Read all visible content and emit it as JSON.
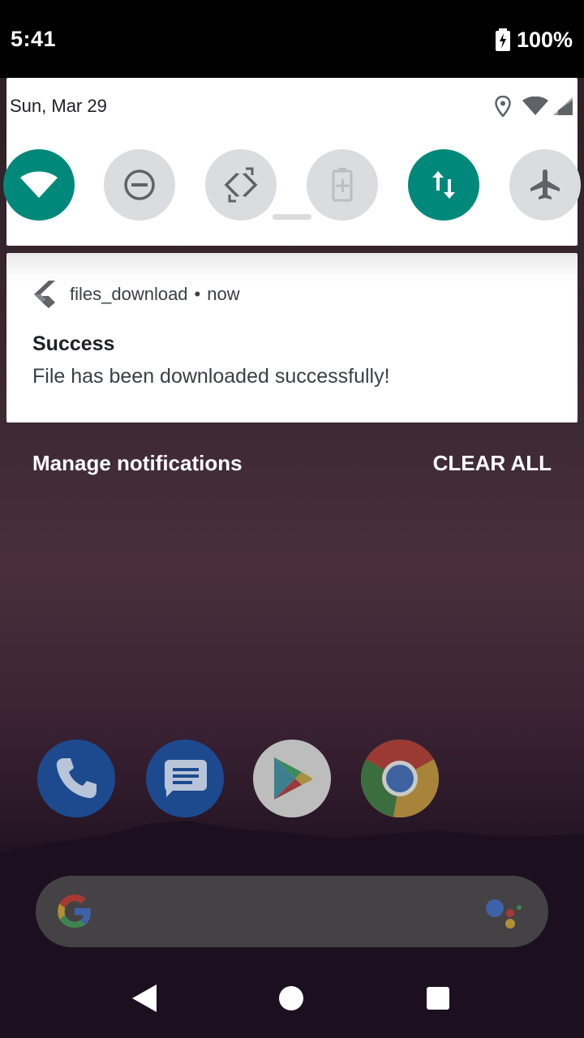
{
  "status_bar": {
    "time": "5:41",
    "battery": "100%"
  },
  "quick_settings": {
    "date": "Sun, Mar 29",
    "accent": "#00897b",
    "tiles": [
      {
        "name": "wifi",
        "icon": "wifi-icon",
        "active": true
      },
      {
        "name": "do-not-disturb",
        "icon": "do-not-disturb-icon",
        "active": false
      },
      {
        "name": "auto-rotate",
        "icon": "auto-rotate-icon",
        "active": false
      },
      {
        "name": "battery-saver",
        "icon": "battery-saver-icon",
        "active": false
      },
      {
        "name": "mobile-data",
        "icon": "mobile-data-icon",
        "active": true
      },
      {
        "name": "airplane-mode",
        "icon": "airplane-icon",
        "active": false
      }
    ]
  },
  "notification": {
    "app_name": "files_download",
    "separator": "•",
    "time": "now",
    "title": "Success",
    "body": "File has been downloaded successfully!"
  },
  "actions": {
    "manage": "Manage notifications",
    "clear_all": "CLEAR ALL"
  },
  "dock": [
    "phone-app",
    "messages-app",
    "play-store-app",
    "chrome-app"
  ],
  "search": {
    "logo": "google-g-icon",
    "assistant": "assistant-icon"
  },
  "nav": [
    "back-button",
    "home-button",
    "recents-button"
  ]
}
